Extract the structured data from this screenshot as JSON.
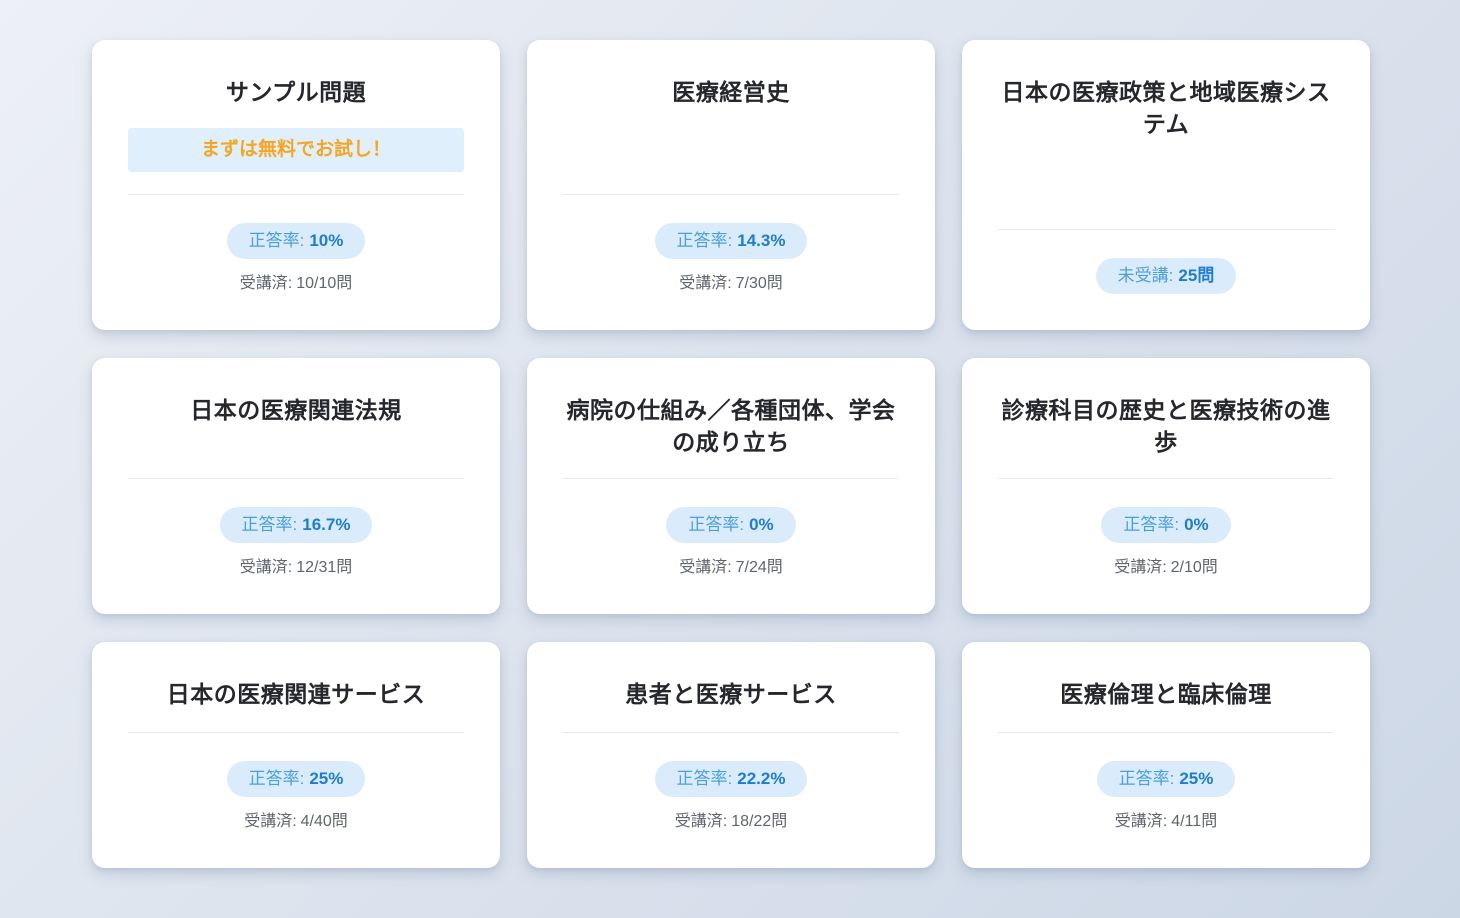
{
  "theme": {
    "bg_start": "#edf0f6",
    "bg_end": "#ccd7e6",
    "card_bg": "#ffffff",
    "title_color": "#26272c",
    "divider_color": "#e8eaee",
    "badge_bg": "#daecfb",
    "badge_label_color": "#4aa0dd",
    "badge_value_color": "#1d7dd3",
    "banner_bg": "#dff0fc",
    "banner_text": "#f5a623",
    "stats_color": "#5f656e"
  },
  "cards": [
    {
      "title": "サンプル問題",
      "banner": "まずは無料でお試し！",
      "badge_label": "正答率:",
      "badge_value": "10%",
      "progress_label": "受講済:",
      "progress_value": "10/10問"
    },
    {
      "title": "医療経営史",
      "badge_label": "正答率:",
      "badge_value": "14.3%",
      "progress_label": "受講済:",
      "progress_value": "7/30問"
    },
    {
      "title": "日本の医療政策と地域医療システム",
      "badge_label": "未受講:",
      "badge_value": "25問"
    },
    {
      "title": "日本の医療関連法規",
      "badge_label": "正答率:",
      "badge_value": "16.7%",
      "progress_label": "受講済:",
      "progress_value": "12/31問"
    },
    {
      "title": "病院の仕組み／各種団体、学会の成り立ち",
      "badge_label": "正答率:",
      "badge_value": "0%",
      "progress_label": "受講済:",
      "progress_value": "7/24問"
    },
    {
      "title": "診療科目の歴史と医療技術の進歩",
      "badge_label": "正答率:",
      "badge_value": "0%",
      "progress_label": "受講済:",
      "progress_value": "2/10問"
    },
    {
      "title": "日本の医療関連サービス",
      "badge_label": "正答率:",
      "badge_value": "25%",
      "progress_label": "受講済:",
      "progress_value": "4/40問"
    },
    {
      "title": "患者と医療サービス",
      "badge_label": "正答率:",
      "badge_value": "22.2%",
      "progress_label": "受講済:",
      "progress_value": "18/22問"
    },
    {
      "title": "医療倫理と臨床倫理",
      "badge_label": "正答率:",
      "badge_value": "25%",
      "progress_label": "受講済:",
      "progress_value": "4/11問"
    }
  ]
}
